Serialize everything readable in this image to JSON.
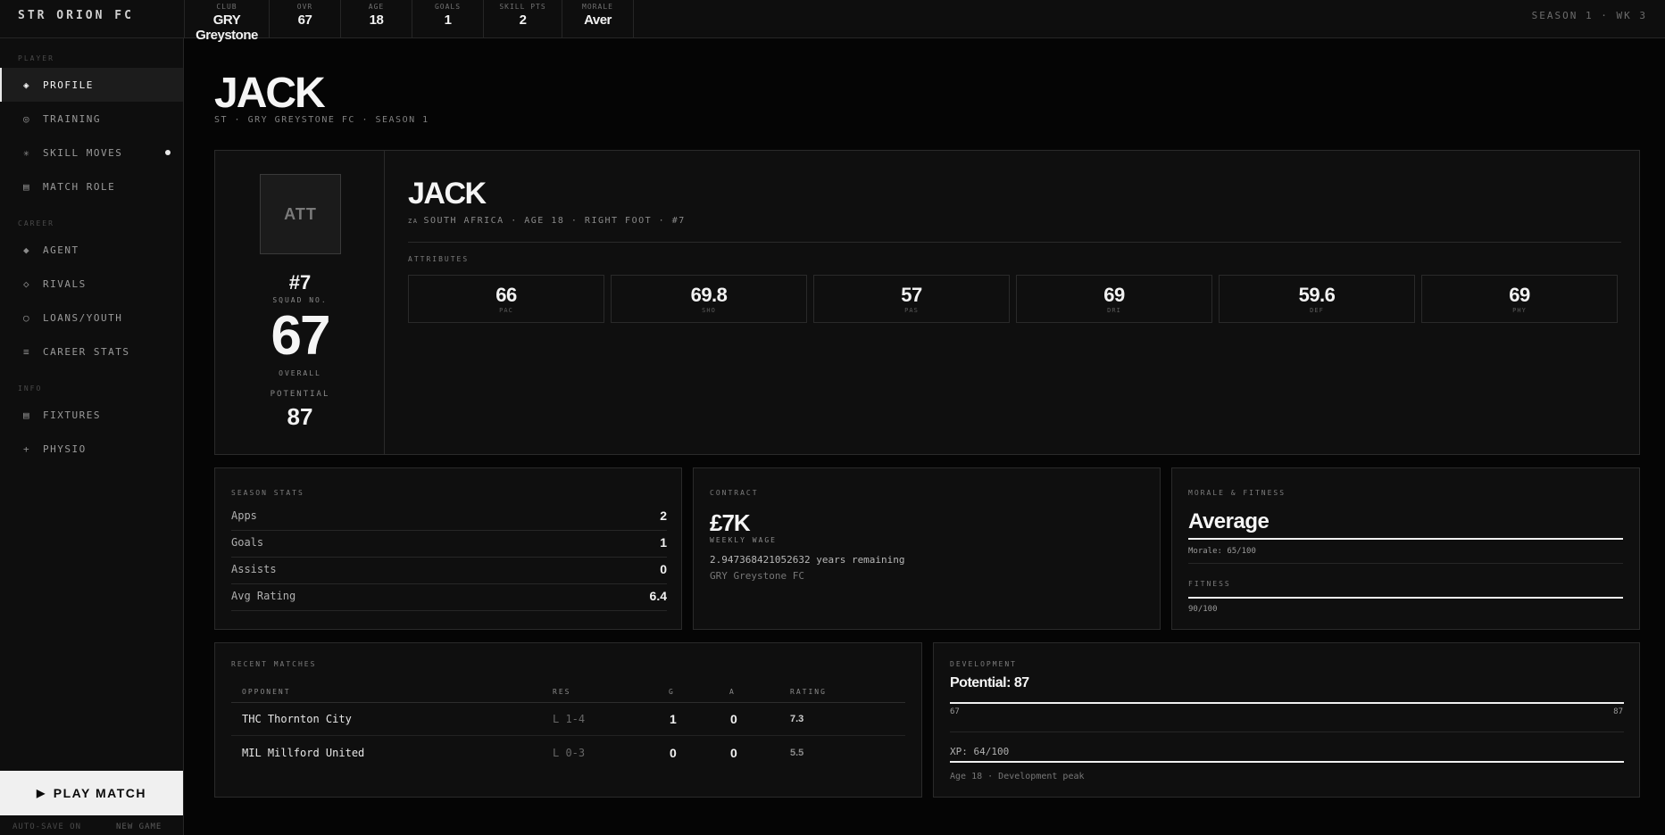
{
  "brand": "STR ORION FC",
  "topbar": {
    "stats": [
      {
        "label": "CLUB",
        "value": "GRY Greystone"
      },
      {
        "label": "OVR",
        "value": "67"
      },
      {
        "label": "AGE",
        "value": "18"
      },
      {
        "label": "GOALS",
        "value": "1"
      },
      {
        "label": "SKILL PTS",
        "value": "2"
      },
      {
        "label": "MORALE",
        "value": "Aver"
      }
    ],
    "season": "SEASON 1 · WK 3"
  },
  "sidebar": {
    "sections": {
      "player": "PLAYER",
      "career": "CAREER",
      "info": "INFO"
    },
    "items": [
      {
        "icon": "◈",
        "label": "PROFILE"
      },
      {
        "icon": "◎",
        "label": "TRAINING"
      },
      {
        "icon": "✳",
        "label": "SKILL MOVES"
      },
      {
        "icon": "▤",
        "label": "MATCH ROLE"
      },
      {
        "icon": "◆",
        "label": "AGENT"
      },
      {
        "icon": "◇",
        "label": "RIVALS"
      },
      {
        "icon": "○",
        "label": "LOANS/YOUTH"
      },
      {
        "icon": "≡",
        "label": "CAREER STATS"
      },
      {
        "icon": "▤",
        "label": "FIXTURES"
      },
      {
        "icon": "+",
        "label": "PHYSIO"
      }
    ],
    "play_button": "PLAY MATCH",
    "autosave": "AUTO-SAVE ON",
    "new_game": "NEW GAME"
  },
  "page": {
    "title": "JACK",
    "subtitle": "ST · GRY GREYSTONE FC · SEASON 1"
  },
  "hero": {
    "badge": "ATT",
    "squad_no": "#7",
    "squad_label": "SQUAD NO.",
    "overall": "67",
    "overall_label": "OVERALL",
    "potential_label": "POTENTIAL",
    "potential": "87",
    "name": "JACK",
    "flag": "ZA",
    "meta": "SOUTH AFRICA · AGE 18 · RIGHT FOOT · #7",
    "attributes_label": "ATTRIBUTES",
    "attributes": [
      {
        "value": "66",
        "label": "PAC"
      },
      {
        "value": "69.8",
        "label": "SHO"
      },
      {
        "value": "57",
        "label": "PAS"
      },
      {
        "value": "69",
        "label": "DRI"
      },
      {
        "value": "59.6",
        "label": "DEF"
      },
      {
        "value": "69",
        "label": "PHY"
      }
    ]
  },
  "season_stats": {
    "label": "SEASON STATS",
    "rows": [
      {
        "k": "Apps",
        "v": "2"
      },
      {
        "k": "Goals",
        "v": "1"
      },
      {
        "k": "Assists",
        "v": "0"
      },
      {
        "k": "Avg Rating",
        "v": "6.4"
      }
    ]
  },
  "contract": {
    "label": "CONTRACT",
    "wage": "£7K",
    "wage_label": "WEEKLY WAGE",
    "remaining": "2.947368421052632 years remaining",
    "club": "GRY Greystone FC"
  },
  "morale": {
    "label": "MORALE & FITNESS",
    "value": "Average",
    "morale_text": "Morale: 65/100",
    "morale_level": 1.0,
    "fitness_label": "FITNESS",
    "fitness_text": "90/100",
    "fitness_level": 1.0
  },
  "recent": {
    "label": "RECENT MATCHES",
    "headers": [
      "OPPONENT",
      "RES",
      "G",
      "A",
      "RATING"
    ],
    "rows": [
      {
        "opp": "THC Thornton City",
        "res": "L 1-4",
        "g": "1",
        "a": "0",
        "rating": "7.3"
      },
      {
        "opp": "MIL Millford United",
        "res": "L 0-3",
        "g": "0",
        "a": "0",
        "rating": "5.5"
      }
    ]
  },
  "development": {
    "label": "DEVELOPMENT",
    "potential_text": "Potential: 87",
    "min": "67",
    "max": "87",
    "progress": 1.0,
    "xp_text": "XP: 64/100",
    "xp_progress": 1.0,
    "note": "Age 18 · Development peak"
  },
  "colors": {
    "background": "#050505",
    "panel": "#0f0f0f",
    "accent": "#f0f0f0"
  }
}
